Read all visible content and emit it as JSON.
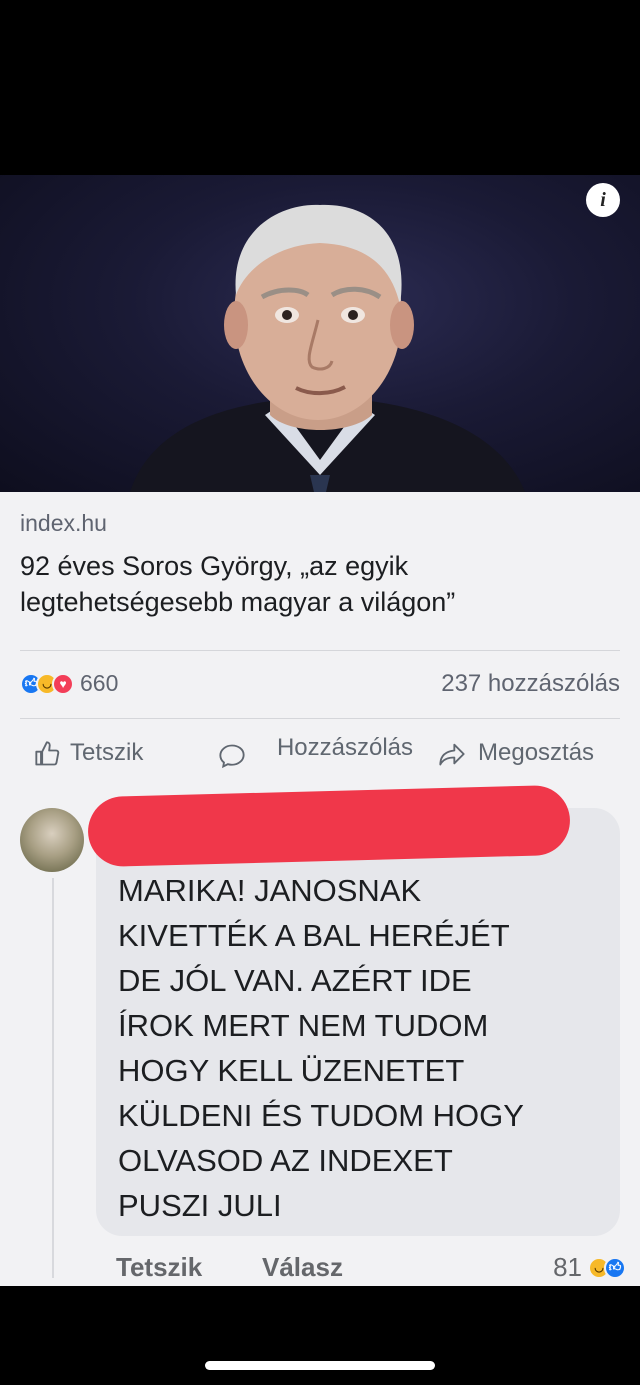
{
  "post": {
    "source": "index.hu",
    "headline": "92 éves Soros György, „az egyik legtehetségesebb magyar a világon”",
    "reaction_count": "660",
    "comments_count": "237 hozzászólás"
  },
  "actions": {
    "like": "Tetszik",
    "comment": "Hozzászólás",
    "share": "Megosztás"
  },
  "comment": {
    "text": "MARIKA! JANOSNAK\nKIVETTÉK A BAL HERÉJÉT\nDE JÓL VAN. AZÉRT IDE\nÍROK MERT NEM TUDOM\nHOGY KELL ÜZENETET\nKÜLDENI ÉS TUDOM HOGY\nOLVASOD AZ INDEXET\nPUSZI JULI",
    "like_label": "Tetszik",
    "reply_label": "Válasz",
    "reaction_count": "81"
  },
  "icons": {
    "info": "info-icon",
    "like": "thumbs-up-icon",
    "comment": "speech-bubble-icon",
    "share": "share-arrow-icon"
  },
  "colors": {
    "like_blue": "#1877f2",
    "haha_yellow": "#f7b928",
    "love_red": "#f33e58",
    "redaction": "#f0374a"
  }
}
